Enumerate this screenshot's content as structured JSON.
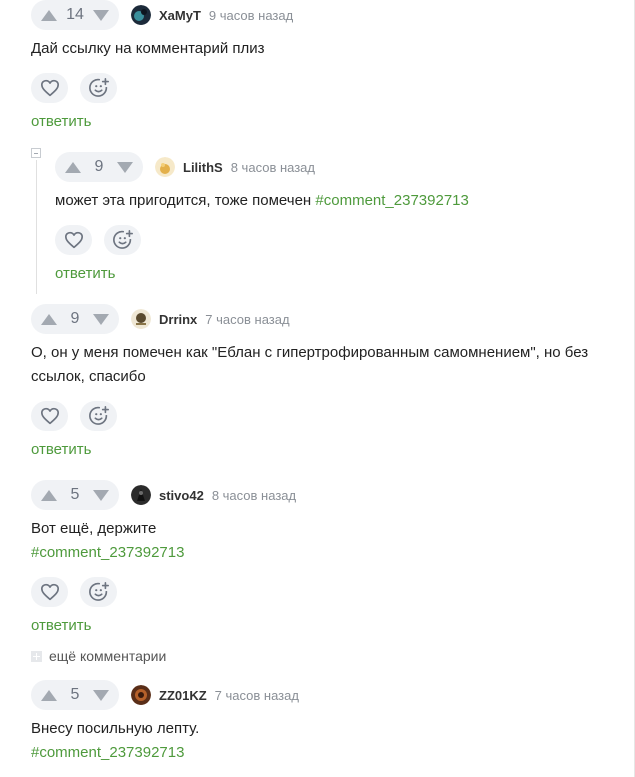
{
  "comments": [
    {
      "score": "14",
      "user": "ХаМуТ",
      "time": "9 часов назад",
      "text": "Дай ссылку на комментарий плиз",
      "reply": "ответить"
    },
    {
      "score": "9",
      "user": "LilithS",
      "time": "8 часов назад",
      "text": "может эта пригодится, тоже помечен ",
      "link": "#comment_237392713",
      "reply": "ответить"
    },
    {
      "score": "9",
      "user": "Drrinx",
      "time": "7 часов назад",
      "text_line1": "О, он у меня помечен как \"Еблан с гипертрофированным самомнением\", но без",
      "text_line2": "ссылок, спасибо",
      "reply": "ответить"
    },
    {
      "score": "5",
      "user": "stivo42",
      "time": "8 часов назад",
      "text": "Вот ещё, держите",
      "link": "#comment_237392713",
      "reply": "ответить"
    },
    {
      "score": "5",
      "user": "ZZ01KZ",
      "time": "7 часов назад",
      "text": "Внесу посильную лепту.",
      "link": "#comment_237392713"
    }
  ],
  "more_comments": "ещё комментарии",
  "icons": {
    "upvote": "arrow-up-icon",
    "downvote": "arrow-down-icon",
    "like": "heart-icon",
    "reaction": "add-emoji-icon"
  },
  "colors": {
    "link_green": "#4e9a3c",
    "pill_bg": "#f0f2f5",
    "icon_gray": "#a3a9b1"
  }
}
